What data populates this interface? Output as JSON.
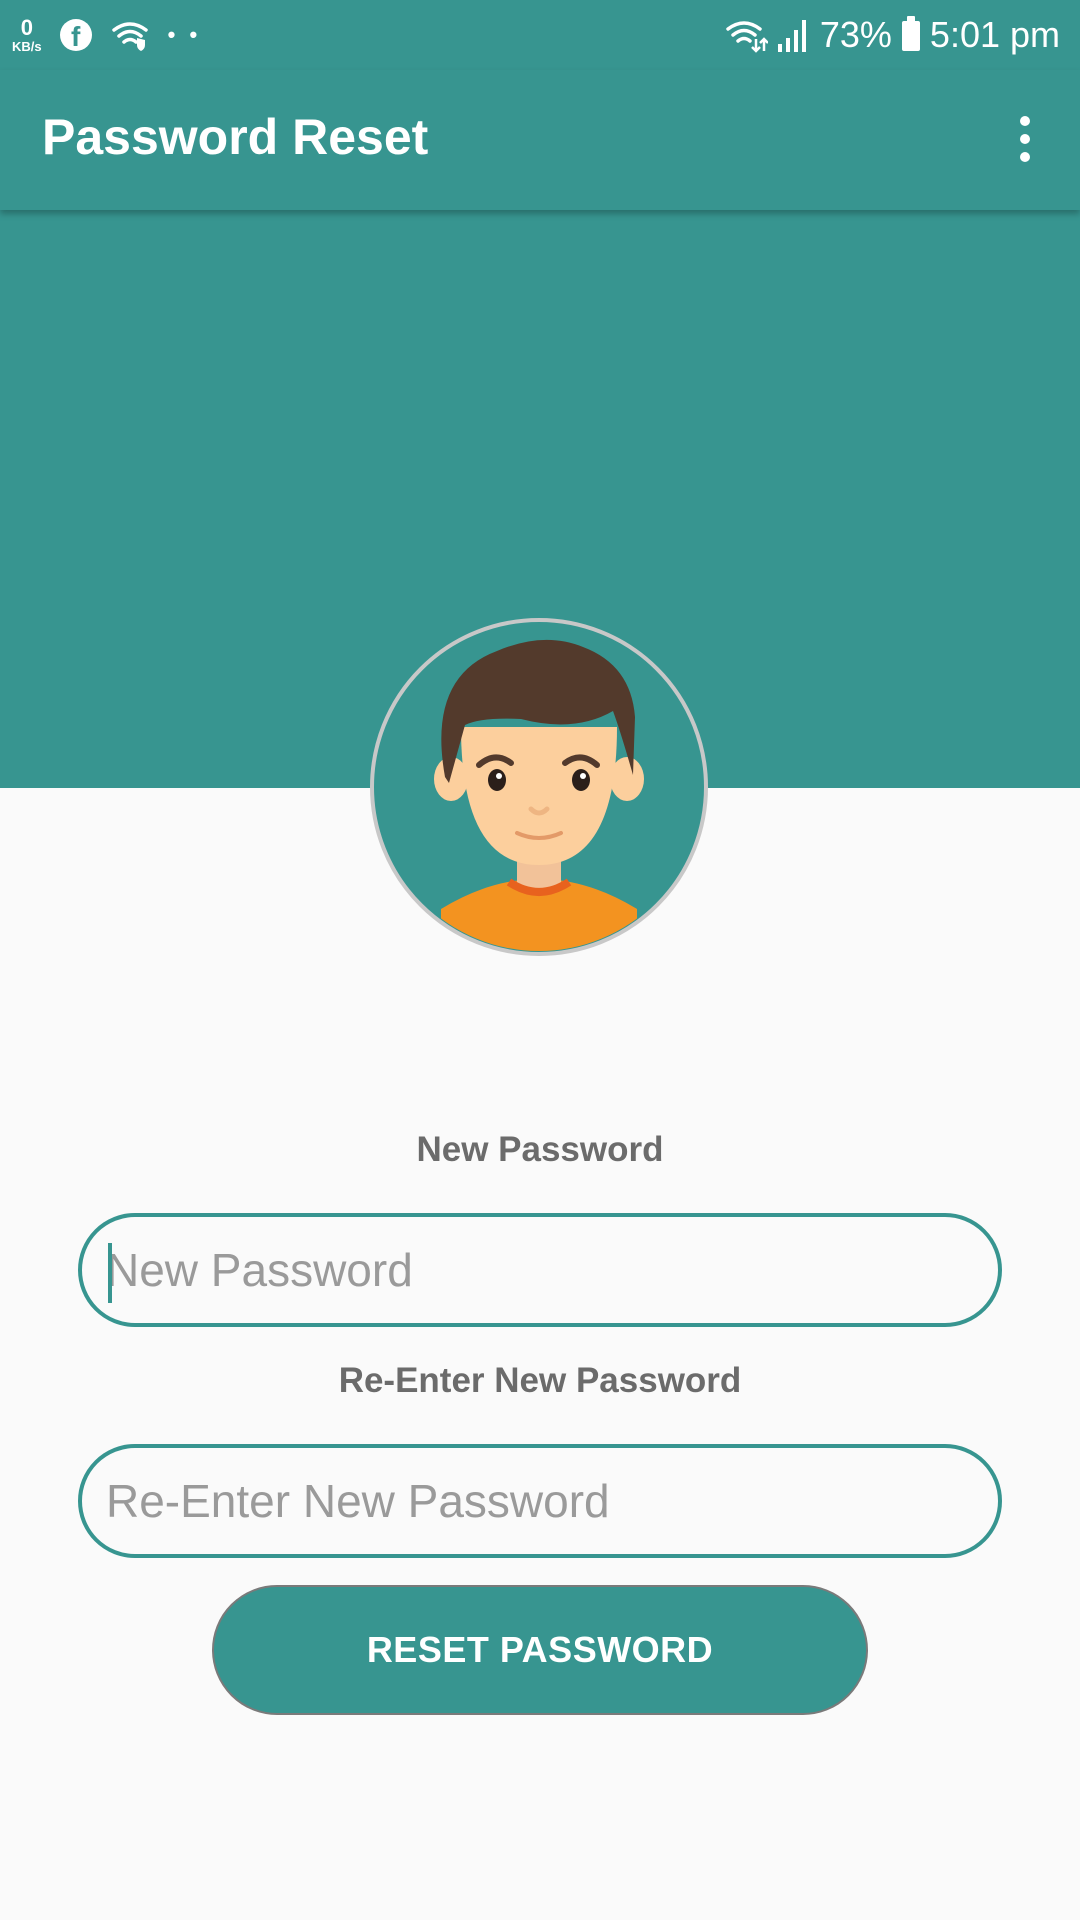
{
  "status_bar": {
    "net_speed_value": "0",
    "net_speed_unit": "KB/s",
    "notification_dots": "• •",
    "battery_percent": "73%",
    "time": "5:01 pm"
  },
  "app_bar": {
    "title": "Password Reset"
  },
  "form": {
    "new_password_label": "New Password",
    "new_password_placeholder": "New Password",
    "reenter_label": "Re-Enter New Password",
    "reenter_placeholder": "Re-Enter New Password",
    "reset_button": "RESET PASSWORD"
  },
  "colors": {
    "primary": "#379590",
    "background": "#fafafa",
    "label_text": "#6b6b6b",
    "placeholder_text": "#9a9a9a"
  },
  "icons": {
    "status_left": [
      "facebook-icon",
      "wifi-secure-icon"
    ],
    "status_right": [
      "wifi-data-icon",
      "signal-icon",
      "battery-icon"
    ],
    "app_bar": [
      "more-vert-icon"
    ],
    "avatar": "avatar-boy-icon"
  }
}
